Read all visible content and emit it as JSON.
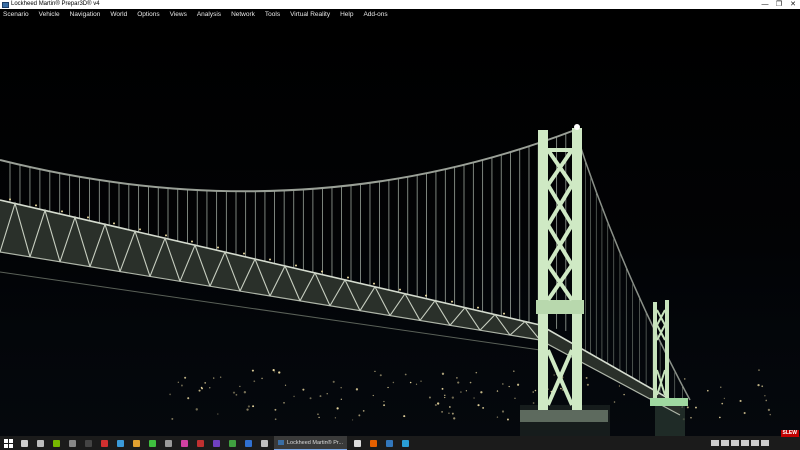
{
  "window": {
    "title": "Lockheed Martin® Prepar3D® v4",
    "minimize_glyph": "—",
    "restore_glyph": "❐",
    "close_glyph": "✕"
  },
  "menu": {
    "items": [
      {
        "label": "Scenario",
        "name": "menu-scenario"
      },
      {
        "label": "Vehicle",
        "name": "menu-vehicle"
      },
      {
        "label": "Navigation",
        "name": "menu-navigation"
      },
      {
        "label": "World",
        "name": "menu-world"
      },
      {
        "label": "Options",
        "name": "menu-options"
      },
      {
        "label": "Views",
        "name": "menu-views"
      },
      {
        "label": "Analysis",
        "name": "menu-analysis"
      },
      {
        "label": "Network",
        "name": "menu-network"
      },
      {
        "label": "Tools",
        "name": "menu-tools"
      },
      {
        "label": "Virtual Reality",
        "name": "menu-virtual-reality"
      },
      {
        "label": "Help",
        "name": "menu-help"
      },
      {
        "label": "Add-ons",
        "name": "menu-add-ons"
      }
    ]
  },
  "status": {
    "slew_label": "SLEW"
  },
  "taskbar": {
    "active_task_label": "Lockheed Martin® Pr...",
    "pinned_left": [
      {
        "icon": "search-icon",
        "color": "#cfcfcf"
      },
      {
        "icon": "task-view-icon",
        "color": "#bdbdbd"
      },
      {
        "icon": "nvidia-icon",
        "color": "#76b900"
      },
      {
        "icon": "app-icon",
        "color": "#888888"
      },
      {
        "icon": "terminal-icon",
        "color": "#444444"
      },
      {
        "icon": "app-red-icon",
        "color": "#d03030"
      },
      {
        "icon": "app-x-icon",
        "color": "#3a9ad9"
      },
      {
        "icon": "tools-icon",
        "color": "#e0a030"
      },
      {
        "icon": "app-green-icon",
        "color": "#3fbf3f"
      },
      {
        "icon": "app-gray-icon",
        "color": "#9a9a9a"
      },
      {
        "icon": "app-pink-icon",
        "color": "#d040a0"
      },
      {
        "icon": "app-red2-icon",
        "color": "#c03030"
      },
      {
        "icon": "app-purple-icon",
        "color": "#7040c0"
      },
      {
        "icon": "app-green2-icon",
        "color": "#40a040"
      },
      {
        "icon": "app-blue-icon",
        "color": "#3070d0"
      },
      {
        "icon": "settings-icon",
        "color": "#c0c0c0"
      }
    ],
    "pinned_right": [
      {
        "icon": "chrome-icon",
        "color": "#dddddd"
      },
      {
        "icon": "firefox-icon",
        "color": "#e66000"
      },
      {
        "icon": "edge-icon",
        "color": "#3277bc"
      },
      {
        "icon": "app-icon",
        "color": "#2a9fd6"
      }
    ],
    "tray": [
      {
        "icon": "user-icon",
        "color": "#cccccc"
      },
      {
        "icon": "network-icon",
        "color": "#cccccc"
      },
      {
        "icon": "volume-icon",
        "color": "#cccccc"
      },
      {
        "icon": "keyboard-icon",
        "color": "#cccccc"
      },
      {
        "icon": "onedrive-icon",
        "color": "#cccccc"
      },
      {
        "icon": "notification-icon",
        "color": "#cccccc"
      }
    ]
  },
  "colors": {
    "tower_glow": "#cfe9c4",
    "deck_light": "#c8cfc2",
    "city_lights": "#e9d8a0",
    "taskbar_accent": "#7aa7e8"
  }
}
